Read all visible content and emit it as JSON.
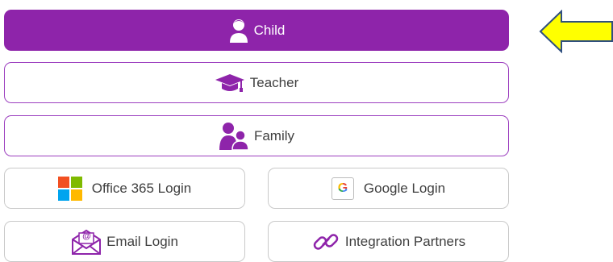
{
  "roles": {
    "child_label": "Child",
    "teacher_label": "Teacher",
    "family_label": "Family"
  },
  "alt_logins": {
    "office_label": "Office 365 Login",
    "google_label": "Google Login",
    "google_glyph": "G",
    "email_label": "Email Login",
    "email_glyph": "@",
    "integration_label": "Integration Partners"
  },
  "icons": {
    "child": "child-person-icon",
    "teacher": "graduation-cap-icon",
    "family": "family-people-icon",
    "office": "microsoft-logo-icon",
    "google": "google-logo-icon",
    "email": "envelope-at-icon",
    "integration": "link-chain-icon",
    "pointer": "left-arrow-icon"
  },
  "colors": {
    "accent": "#8e24aa",
    "pointer_fill": "#ffff00",
    "pointer_stroke": "#2f4f7f"
  }
}
